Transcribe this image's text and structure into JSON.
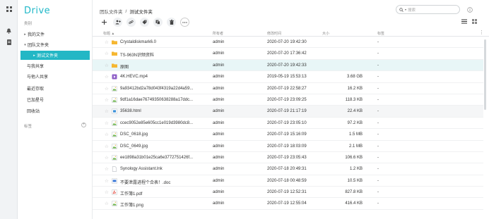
{
  "app": {
    "logo": "Drive"
  },
  "sidebar": {
    "section_files": "类别",
    "items": [
      {
        "label": "我的文件",
        "arrow": "▸"
      },
      {
        "label": "团队文件夹",
        "arrow": "▾"
      },
      {
        "label": "测试文件夹",
        "arrow": "▸"
      },
      {
        "label": "与我共享",
        "arrow": ""
      },
      {
        "label": "与他人共享",
        "arrow": ""
      },
      {
        "label": "最近存取",
        "arrow": ""
      },
      {
        "label": "已加星号",
        "arrow": ""
      },
      {
        "label": "回收站",
        "arrow": ""
      }
    ],
    "section_labels": "标签"
  },
  "breadcrumb": {
    "parent": "团队文件夹",
    "sep": "/",
    "current": "测试文件夹"
  },
  "search": {
    "placeholder": "搜索"
  },
  "table": {
    "headers": {
      "name": "标题 ▲",
      "owner": "所有者",
      "modified": "修改时间",
      "size": "大小",
      "label": "标签"
    },
    "rows": [
      {
        "name": "Crystaldiskmark6.0",
        "type": "folder",
        "owner": "admin",
        "modified": "2020-07-20 19:42:30",
        "size": "",
        "label": "-"
      },
      {
        "name": "TS-963N识频资料",
        "type": "folder",
        "owner": "admin",
        "modified": "2020-07-20 17:36:42",
        "size": "",
        "label": "-"
      },
      {
        "name": "原图",
        "type": "folder",
        "owner": "admin",
        "modified": "2020-07-20 19:42:33",
        "size": "",
        "label": "-"
      },
      {
        "name": "4K.HEVC.mp4",
        "type": "video",
        "owner": "admin",
        "modified": "2019-05-19 15:53:13",
        "size": "3.68 GB",
        "label": "-"
      },
      {
        "name": "9a93412bd2a78d043f4319a22d4a59...",
        "type": "image",
        "owner": "admin",
        "modified": "2020-07-19 22:58:27",
        "size": "16.2 KB",
        "label": "-"
      },
      {
        "name": "9df1a16dae76749350638288a17ddc...",
        "type": "image",
        "owner": "admin",
        "modified": "2020-07-19 23:09:25",
        "size": "118.3 KB",
        "label": "-"
      },
      {
        "name": "35638.html",
        "type": "html",
        "owner": "admin",
        "modified": "2020-07-19 21:17:19",
        "size": "22.4 KB",
        "label": "-"
      },
      {
        "name": "ccec9052e85e605cc1e019d3980dc8...",
        "type": "image",
        "owner": "admin",
        "modified": "2020-07-19 23:05:10",
        "size": "97.2 KB",
        "label": "-"
      },
      {
        "name": "DSC_0618.jpg",
        "type": "image",
        "owner": "admin",
        "modified": "2020-07-19 15:16:09",
        "size": "1.5 MB",
        "label": "-"
      },
      {
        "name": "DSC_0649.jpg",
        "type": "image",
        "owner": "admin",
        "modified": "2020-07-19 18:03:09",
        "size": "2.1 MB",
        "label": "-"
      },
      {
        "name": "ee1898a31b01e25ca6e3772751426f...",
        "type": "image",
        "owner": "admin",
        "modified": "2020-07-19 23:05:43",
        "size": "106.6 KB",
        "label": "-"
      },
      {
        "name": "Synology Assistant.lnk",
        "type": "file",
        "owner": "admin",
        "modified": "2020-07-18 20:49:31",
        "size": "1.2 KB",
        "label": "-"
      },
      {
        "name": "不要泄露进程个合表！.doc",
        "type": "doc",
        "owner": "admin",
        "modified": "2020-07-18 00:48:59",
        "size": "10.5 KB",
        "label": "-"
      },
      {
        "name": "工作簿1.pdf",
        "type": "pdf",
        "owner": "admin",
        "modified": "2020-07-19 12:52:31",
        "size": "827.8 KB",
        "label": "-"
      },
      {
        "name": "工作簿1.png",
        "type": "image",
        "owner": "admin",
        "modified": "2020-07-19 12:55:04",
        "size": "416.4 KB",
        "label": "-"
      }
    ]
  },
  "colors": {
    "accent": "#23b7c5",
    "folder": "#f5b731",
    "video": "#8e5fc7",
    "image": "#6bb24a",
    "html": "#3a8fd8",
    "pdf": "#e0473c",
    "doc": "#3a78d8"
  }
}
